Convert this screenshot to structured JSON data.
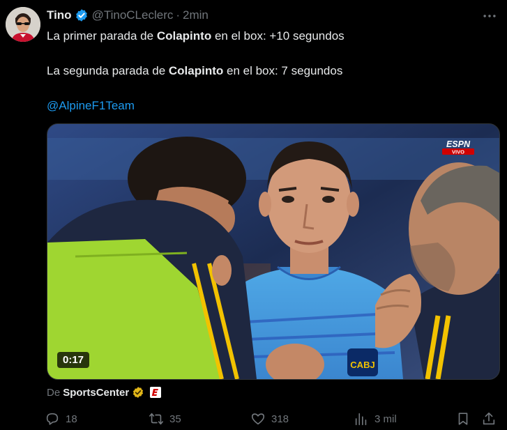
{
  "tweet": {
    "author_name": "Tino",
    "author_handle": "@TinoCLeclerc",
    "separator": "·",
    "time": "2min",
    "line1_prefix": "La primer parada de ",
    "line1_bold": "Colapinto",
    "line1_suffix": " en el box: +10 segundos",
    "line2_prefix": "La segunda parada de ",
    "line2_bold": "Colapinto",
    "line2_suffix": " en el box: 7 segundos",
    "mention": "@AlpineF1Team"
  },
  "media": {
    "duration": "0:17",
    "overlay_logo": "ESPN",
    "overlay_tag": "VIVO",
    "jersey_text": "CABJ"
  },
  "attribution": {
    "prefix": "De",
    "source": "SportsCenter"
  },
  "actions": {
    "replies": "18",
    "retweets": "35",
    "likes": "318",
    "views": "3 mil"
  },
  "icons": {
    "verified": "verified-badge-icon",
    "gold": "gold-verified-badge-icon",
    "more": "more-options-icon",
    "reply": "reply-icon",
    "retweet": "retweet-icon",
    "like": "heart-icon",
    "views": "views-icon",
    "bookmark": "bookmark-icon",
    "share": "share-icon"
  },
  "colors": {
    "background": "#000000",
    "text": "#e7e9ea",
    "muted": "#71767b",
    "link": "#1d9bf0",
    "verified_blue": "#1d9bf0",
    "verified_gold": "#e2b719",
    "espn_red": "#d00000"
  }
}
